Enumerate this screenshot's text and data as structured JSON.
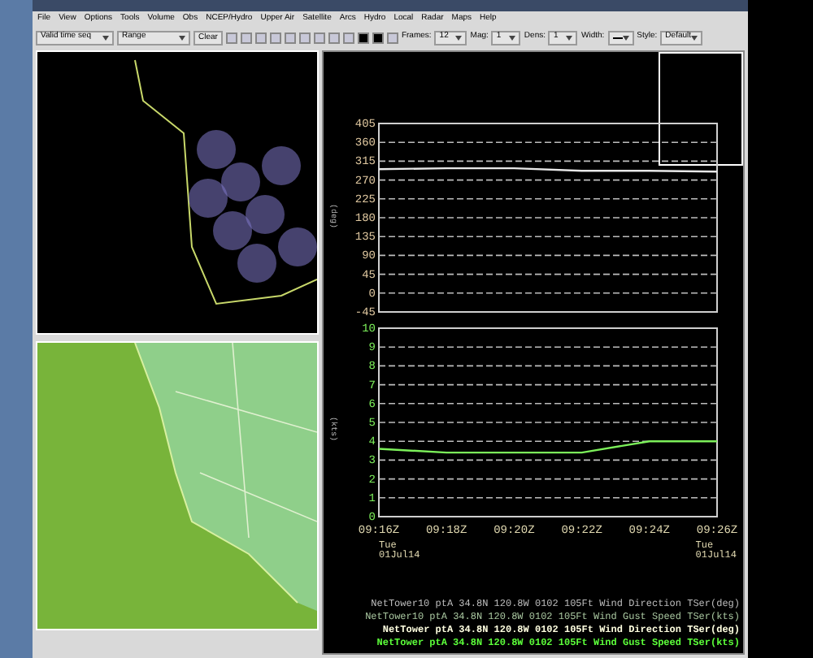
{
  "menu_bar": {
    "items": [
      "File",
      "View",
      "Options",
      "Tools",
      "Volume",
      "Obs",
      "NCEP/Hydro",
      "Upper Air",
      "Satellite",
      "Arcs",
      "Hydro",
      "Local",
      "Radar",
      "Maps",
      "Help"
    ]
  },
  "toolbar": {
    "time_mode": "Valid time seq",
    "range": "Range",
    "clear_button": "Clear",
    "frames_label": "Frames:",
    "frames": "12",
    "mag_label": "Mag:",
    "mag": "1",
    "dens_label": "Dens:",
    "dens": "1",
    "width_label": "Width:",
    "style_label": "Style:",
    "style": "Default"
  },
  "time_series": {
    "charts": [
      {
        "ylabel": "(deg)",
        "chart_data": {
          "type": "line",
          "grid": true,
          "ylim": [
            -45,
            405
          ],
          "yticks": [
            -45,
            0,
            45,
            90,
            135,
            180,
            225,
            270,
            315,
            360,
            405
          ],
          "series": [
            {
              "color": "#e8e8e8",
              "values": [
                296,
                298,
                298,
                292,
                292,
                290
              ]
            }
          ]
        }
      },
      {
        "ylabel": "(kts)",
        "chart_data": {
          "type": "line",
          "grid": true,
          "x": [
            "09:16Z",
            "09:18Z",
            "09:20Z",
            "09:22Z",
            "09:24Z",
            "09:26Z"
          ],
          "ylim": [
            0,
            10
          ],
          "yticks": [
            0,
            1,
            2,
            3,
            4,
            5,
            6,
            7,
            8,
            9,
            10
          ],
          "series": [
            {
              "color": "#7cf05a",
              "values": [
                3.6,
                3.4,
                3.4,
                3.4,
                4,
                4
              ]
            }
          ]
        }
      }
    ],
    "date_start": [
      "Tue",
      "01Jul14"
    ],
    "date_end": [
      "Tue",
      "01Jul14"
    ],
    "legend": [
      {
        "text": "NetTower10 ptA 34.8N 120.8W 0102 105Ft Wind Direction TSer(deg)",
        "color": "#bdbdbd"
      },
      {
        "text": "NetTower10 ptA 34.8N 120.8W 0102 105Ft Wind Gust Speed TSer(kts)",
        "color": "#a9c7a0"
      },
      {
        "text": "NetTower ptA 34.8N 120.8W 0102 105Ft Wind Direction TSer(deg)",
        "color": "#ffffe0"
      },
      {
        "text": "NetTower ptA 34.8N 120.8W 0102 105Ft Wind Gust Speed TSer(kts)",
        "color": "#5cff3a"
      }
    ]
  }
}
